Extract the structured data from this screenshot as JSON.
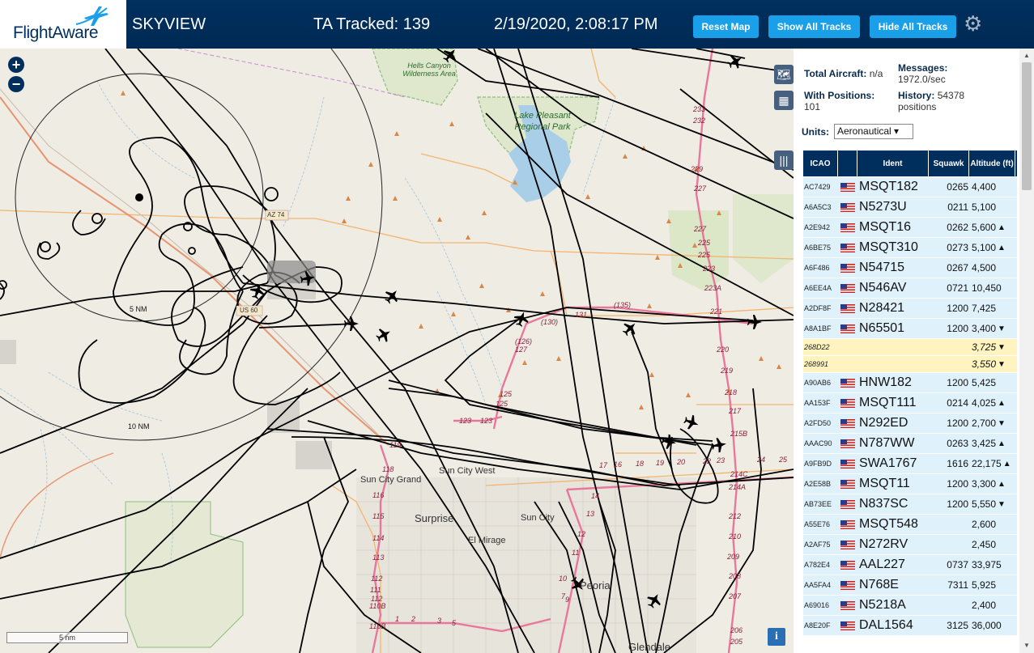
{
  "header": {
    "logo_text": "FlightAware",
    "title": "SKYVIEW",
    "tracked": "TA Tracked: 139",
    "datetime": "2/19/2020, 2:08:17 PM",
    "buttons": {
      "reset": "Reset Map",
      "show_all": "Show All Tracks",
      "hide_all": "Hide All Tracks"
    }
  },
  "map": {
    "zoom_in": "+",
    "zoom_out": "−",
    "info": "i",
    "scale": "5 nm",
    "rings": [
      "5 NM",
      "10 NM"
    ],
    "labels": {
      "wilderness": "Hells Canyon Wilderness Area",
      "lake": "Lake Pleasant Regional Park",
      "sun_city_west": "Sun City West",
      "sun_city_grand": "Sun City Grand",
      "surprise": "Surprise",
      "sun_city": "Sun City",
      "el_mirage": "El Mirage",
      "peoria": "Peoria",
      "glendale": "Glendale",
      "az74": "AZ 74",
      "us60": "US 60"
    },
    "route_labels": [
      "233",
      "232",
      "229",
      "227",
      "227",
      "225",
      "225",
      "223",
      "223A",
      "221",
      "220",
      "219",
      "218",
      "217",
      "215B",
      "131",
      "(135)",
      "(130)",
      "(126)",
      "127",
      "125",
      "125",
      "123",
      "123",
      "119",
      "118",
      "116",
      "115",
      "114",
      "113",
      "112",
      "112",
      "111",
      "110B",
      "110B",
      "17",
      "16",
      "18",
      "19",
      "20",
      "22",
      "23",
      "24",
      "25",
      "1",
      "2",
      "3",
      "5",
      "7",
      "9",
      "10",
      "11",
      "12",
      "13",
      "14",
      "212",
      "210",
      "209",
      "208",
      "207",
      "206",
      "205",
      "214A",
      "214C"
    ],
    "colors": {
      "map_bg": "#efece4",
      "highway": "#e8789b",
      "major_road": "#f4b46e",
      "park_green": "#cfe3b0",
      "water": "#a9cfe8",
      "track": "#000000"
    }
  },
  "sidebar": {
    "total_aircraft_label": "Total Aircraft:",
    "total_aircraft": "n/a",
    "messages_label": "Messages:",
    "messages": "1972.0/sec",
    "with_positions_label": "With Positions:",
    "with_positions": "101",
    "history_label": "History:",
    "history": "54378 positions",
    "units_label": "Units:",
    "units_value": "Aeronautical ▾",
    "columns": {
      "icao": "ICAO",
      "ident": "Ident",
      "squawk": "Squawk",
      "altitude": "Altitude (ft)"
    },
    "rows": [
      {
        "icao": "AC7429",
        "flag": true,
        "ident": "MSQT182",
        "squawk": "0265",
        "alt": "4,400",
        "trend": ""
      },
      {
        "icao": "A6A5C3",
        "flag": true,
        "ident": "N5273U",
        "squawk": "0211",
        "alt": "5,100",
        "trend": ""
      },
      {
        "icao": "A2E942",
        "flag": true,
        "ident": "MSQT16",
        "squawk": "0262",
        "alt": "5,600",
        "trend": "▲"
      },
      {
        "icao": "A6BE75",
        "flag": true,
        "ident": "MSQT310",
        "squawk": "0273",
        "alt": "5,100",
        "trend": "▲"
      },
      {
        "icao": "A6F486",
        "flag": true,
        "ident": "N54715",
        "squawk": "0267",
        "alt": "4,500",
        "trend": ""
      },
      {
        "icao": "A6EE4A",
        "flag": true,
        "ident": "N546AV",
        "squawk": "0721",
        "alt": "10,450",
        "trend": ""
      },
      {
        "icao": "A2DF8F",
        "flag": true,
        "ident": "N28421",
        "squawk": "1200",
        "alt": "7,425",
        "trend": ""
      },
      {
        "icao": "A8A1BF",
        "flag": true,
        "ident": "N65501",
        "squawk": "1200",
        "alt": "3,400",
        "trend": "▼"
      },
      {
        "icao": "268D22",
        "flag": false,
        "ident": "",
        "squawk": "",
        "alt": "3,725",
        "trend": "▼",
        "nopos": true
      },
      {
        "icao": "268991",
        "flag": false,
        "ident": "",
        "squawk": "",
        "alt": "3,550",
        "trend": "▼",
        "nopos": true
      },
      {
        "icao": "A90AB6",
        "flag": true,
        "ident": "HNW182",
        "squawk": "1200",
        "alt": "5,425",
        "trend": ""
      },
      {
        "icao": "AA153F",
        "flag": true,
        "ident": "MSQT111",
        "squawk": "0214",
        "alt": "4,025",
        "trend": "▲"
      },
      {
        "icao": "A2FD50",
        "flag": true,
        "ident": "N292ED",
        "squawk": "1200",
        "alt": "2,700",
        "trend": "▼"
      },
      {
        "icao": "AAAC90",
        "flag": true,
        "ident": "N787WW",
        "squawk": "0263",
        "alt": "3,425",
        "trend": "▲"
      },
      {
        "icao": "A9FB9D",
        "flag": true,
        "ident": "SWA1767",
        "squawk": "1616",
        "alt": "22,175",
        "trend": "▲"
      },
      {
        "icao": "A2E58B",
        "flag": true,
        "ident": "MSQT11",
        "squawk": "1200",
        "alt": "3,300",
        "trend": "▲"
      },
      {
        "icao": "AB73EE",
        "flag": true,
        "ident": "N837SC",
        "squawk": "1200",
        "alt": "5,550",
        "trend": "▼"
      },
      {
        "icao": "A55E76",
        "flag": true,
        "ident": "MSQT548",
        "squawk": "",
        "alt": "2,600",
        "trend": ""
      },
      {
        "icao": "A2AF75",
        "flag": true,
        "ident": "N272RV",
        "squawk": "",
        "alt": "2,450",
        "trend": ""
      },
      {
        "icao": "A782E4",
        "flag": true,
        "ident": "AAL227",
        "squawk": "0737",
        "alt": "33,975",
        "trend": ""
      },
      {
        "icao": "AA5FA4",
        "flag": true,
        "ident": "N768E",
        "squawk": "7311",
        "alt": "5,925",
        "trend": ""
      },
      {
        "icao": "A69016",
        "flag": true,
        "ident": "N5218A",
        "squawk": "",
        "alt": "2,400",
        "trend": ""
      },
      {
        "icao": "A8E20F",
        "flag": true,
        "ident": "DAL1564",
        "squawk": "3125",
        "alt": "36,000",
        "trend": ""
      }
    ]
  }
}
